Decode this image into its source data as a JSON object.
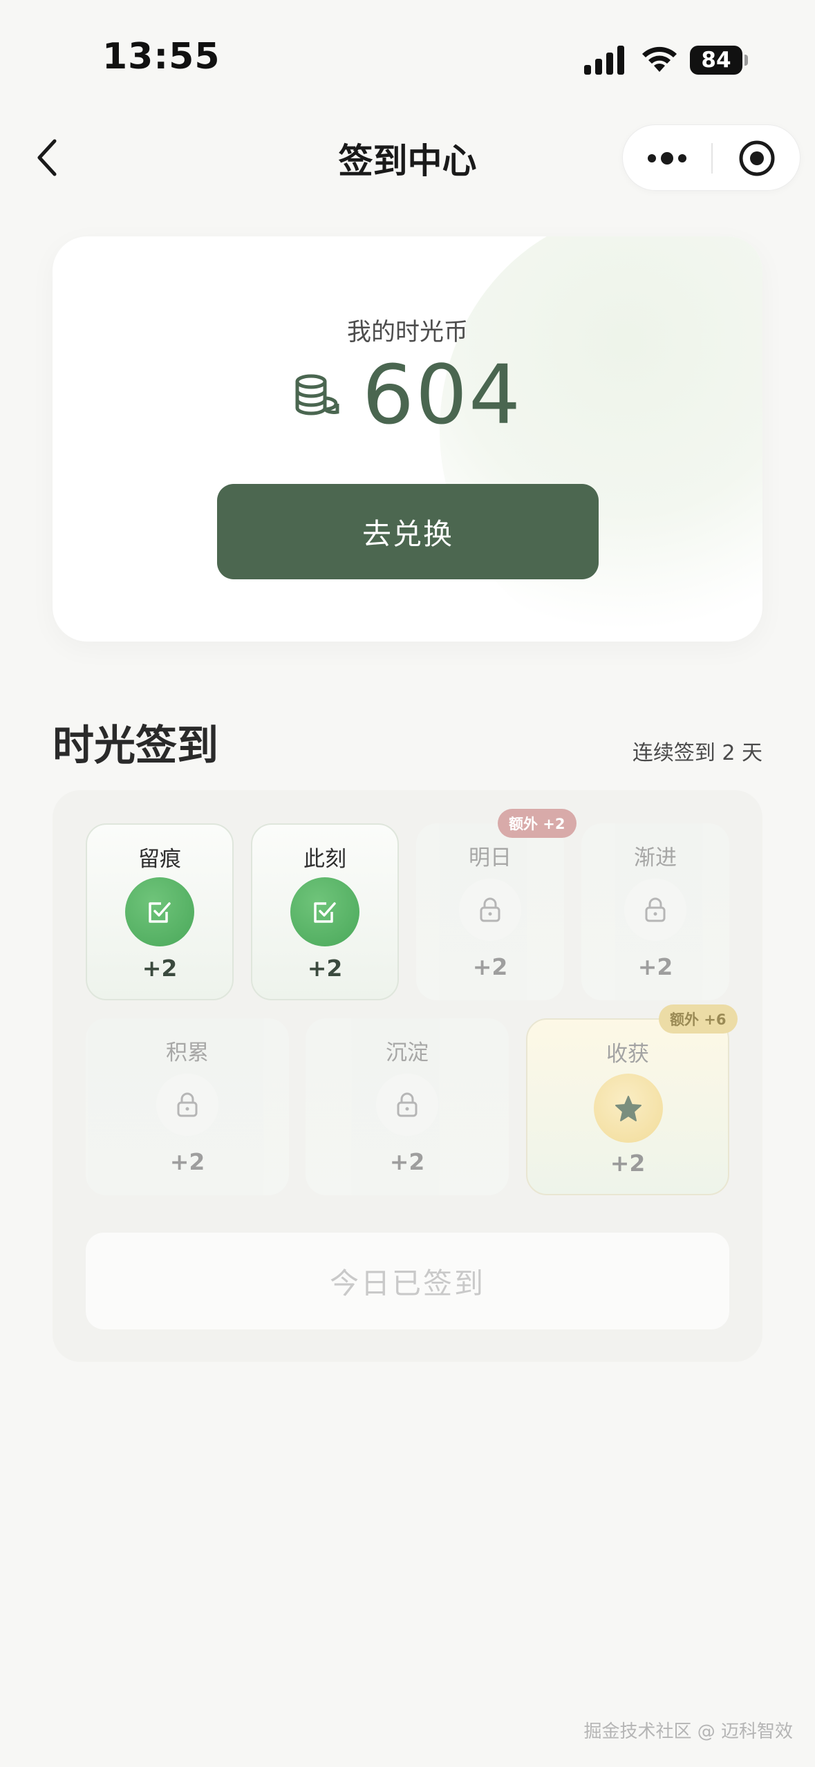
{
  "status_bar": {
    "time": "13:55",
    "battery": "84"
  },
  "nav": {
    "title": "签到中心",
    "icons": {
      "back": "chevron-left-icon",
      "more": "more-dots-icon",
      "close": "target-circle-icon"
    }
  },
  "balance": {
    "label": "我的时光币",
    "value": "604",
    "icon": "coins-icon",
    "exchange_label": "去兑换",
    "accent_color": "#4c6750"
  },
  "checkin": {
    "section_title": "时光签到",
    "streak_text": "连续签到 2 天",
    "days": [
      {
        "name": "留痕",
        "points": "+2",
        "status": "done"
      },
      {
        "name": "此刻",
        "points": "+2",
        "status": "done"
      },
      {
        "name": "明日",
        "points": "+2",
        "status": "locked",
        "bonus": "额外 +2"
      },
      {
        "name": "渐进",
        "points": "+2",
        "status": "locked"
      },
      {
        "name": "积累",
        "points": "+2",
        "status": "locked"
      },
      {
        "name": "沉淀",
        "points": "+2",
        "status": "locked"
      },
      {
        "name": "收获",
        "points": "+2",
        "status": "gift",
        "bonus": "额外 +6"
      }
    ],
    "signed_label": "今日已签到",
    "done_color": "#4aa85a"
  },
  "watermark": "掘金技术社区 @ 迈科智效"
}
